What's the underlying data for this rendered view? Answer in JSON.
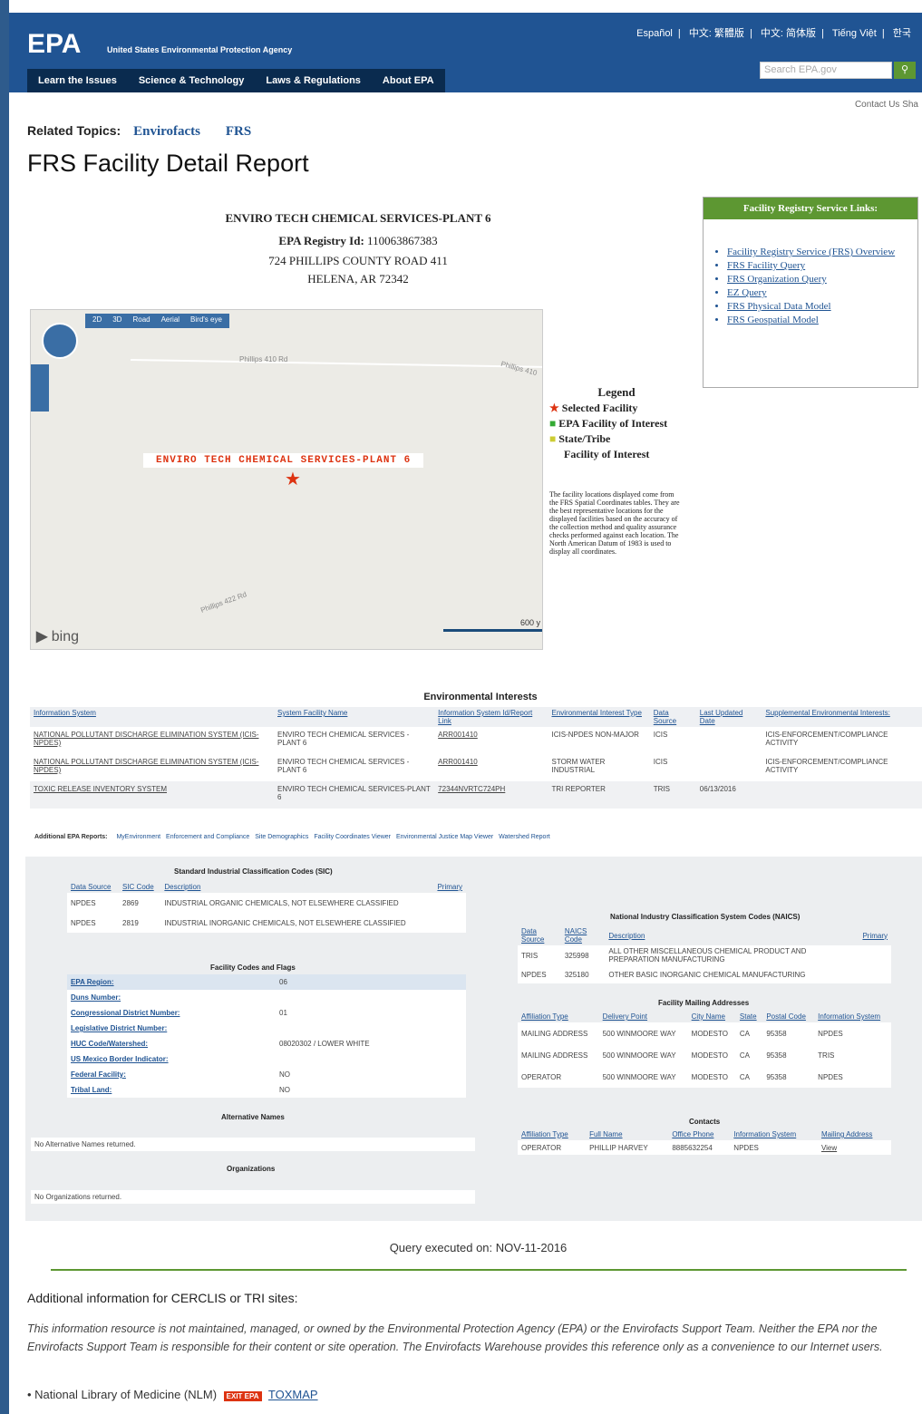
{
  "header": {
    "logo": "EPA",
    "agency": "United States Environmental Protection Agency",
    "languages": [
      "Español",
      "中文: 繁體版",
      "中文: 简体版",
      "Tiếng Việt",
      "한국"
    ],
    "search_placeholder": "Search EPA.gov",
    "nav": [
      "Learn the Issues",
      "Science & Technology",
      "Laws & Regulations",
      "About EPA"
    ],
    "utility": "Contact Us   Sha"
  },
  "related": {
    "label": "Related Topics:",
    "links": [
      "Envirofacts",
      "FRS"
    ]
  },
  "title": "FRS Facility Detail Report",
  "facility": {
    "name": "ENVIRO TECH CHEMICAL SERVICES-PLANT 6",
    "registry_label": "EPA Registry Id:",
    "registry_id": "110063867383",
    "address1": "724 PHILLIPS COUNTY ROAD 411",
    "address2": "HELENA, AR 72342"
  },
  "frs_links": {
    "title": "Facility Registry Service Links:",
    "items": [
      "Facility Registry Service (FRS) Overview",
      "FRS Facility Query",
      "FRS Organization Query",
      "EZ Query",
      "FRS Physical Data Model",
      "FRS Geospatial Model"
    ]
  },
  "map": {
    "toolbar": [
      "2D",
      "3D",
      "Road",
      "Aerial",
      "Bird's eye"
    ],
    "roads": [
      "Phillips 410 Rd",
      "Phillips 410",
      "Phillips 422 Rd"
    ],
    "label": "ENVIRO TECH CHEMICAL SERVICES-PLANT 6",
    "brand": "bing",
    "scale": "600 y"
  },
  "legend": {
    "title": "Legend",
    "items": [
      "Selected Facility",
      "EPA Facility of Interest",
      "State/Tribe",
      "Facility of Interest"
    ],
    "note": "The facility locations displayed come from the FRS Spatial Coordinates tables. They are the best representative locations for the displayed facilities based on the accuracy of the collection method and quality assurance checks performed against each location. The North American Datum of 1983 is used to display all coordinates."
  },
  "env_interests": {
    "title": "Environmental Interests",
    "columns": [
      "Information System",
      "System Facility Name",
      "Information System Id/Report Link",
      "Environmental Interest Type",
      "Data Source",
      "Last Updated Date",
      "Supplemental Environmental Interests:"
    ],
    "rows": [
      [
        "NATIONAL POLLUTANT DISCHARGE ELIMINATION SYSTEM (ICIS-NPDES)",
        "ENVIRO TECH CHEMICAL SERVICES - PLANT 6",
        "ARR001410",
        "ICIS-NPDES NON-MAJOR",
        "ICIS",
        "",
        "ICIS-ENFORCEMENT/COMPLIANCE ACTIVITY"
      ],
      [
        "NATIONAL POLLUTANT DISCHARGE ELIMINATION SYSTEM (ICIS-NPDES)",
        "ENVIRO TECH CHEMICAL SERVICES - PLANT 6",
        "ARR001410",
        "STORM WATER INDUSTRIAL",
        "ICIS",
        "",
        "ICIS-ENFORCEMENT/COMPLIANCE ACTIVITY"
      ],
      [
        "TOXIC RELEASE INVENTORY SYSTEM",
        "ENVIRO TECH CHEMICAL SERVICES-PLANT 6",
        "72344NVRTC724PH",
        "TRI REPORTER",
        "TRIS",
        "06/13/2016",
        ""
      ]
    ]
  },
  "additional_reports": {
    "label": "Additional EPA Reports:",
    "links": [
      "MyEnvironment",
      "Enforcement and Compliance",
      "Site Demographics",
      "Facility Coordinates Viewer",
      "Environmental Justice Map Viewer",
      "Watershed Report"
    ]
  },
  "sic": {
    "title": "Standard Industrial Classification Codes (SIC)",
    "columns": [
      "Data Source",
      "SIC Code",
      "Description",
      "Primary"
    ],
    "rows": [
      [
        "NPDES",
        "2869",
        "INDUSTRIAL ORGANIC CHEMICALS, NOT ELSEWHERE CLASSIFIED",
        ""
      ],
      [
        "NPDES",
        "2819",
        "INDUSTRIAL INORGANIC CHEMICALS, NOT ELSEWHERE CLASSIFIED",
        ""
      ]
    ]
  },
  "flags": {
    "title": "Facility Codes and Flags",
    "rows": [
      [
        "EPA Region:",
        "06"
      ],
      [
        "Duns Number:",
        ""
      ],
      [
        "Congressional District Number:",
        "01"
      ],
      [
        "Legislative District Number:",
        ""
      ],
      [
        "HUC Code/Watershed:",
        "08020302 / LOWER WHITE"
      ],
      [
        "US Mexico Border Indicator:",
        ""
      ],
      [
        "Federal Facility:",
        "NO"
      ],
      [
        "Tribal Land:",
        "NO"
      ]
    ]
  },
  "alt_names": {
    "title": "Alternative Names",
    "text": "No Alternative Names returned."
  },
  "orgs": {
    "title": "Organizations",
    "text": "No Organizations returned."
  },
  "naics": {
    "title": "National Industry Classification System Codes (NAICS)",
    "columns": [
      "Data Source",
      "NAICS Code",
      "Description",
      "Primary"
    ],
    "rows": [
      [
        "TRIS",
        "325998",
        "ALL OTHER MISCELLANEOUS CHEMICAL PRODUCT AND PREPARATION MANUFACTURING",
        ""
      ],
      [
        "NPDES",
        "325180",
        "OTHER BASIC INORGANIC CHEMICAL MANUFACTURING",
        ""
      ]
    ]
  },
  "mailing": {
    "title": "Facility Mailing Addresses",
    "columns": [
      "Affiliation Type",
      "Delivery Point",
      "City Name",
      "State",
      "Postal Code",
      "Information System"
    ],
    "rows": [
      [
        "MAILING ADDRESS",
        "500 WINMOORE WAY",
        "MODESTO",
        "CA",
        "95358",
        "NPDES"
      ],
      [
        "MAILING ADDRESS",
        "500 WINMOORE WAY",
        "MODESTO",
        "CA",
        "95358",
        "TRIS"
      ],
      [
        "OPERATOR",
        "500 WINMOORE WAY",
        "MODESTO",
        "CA",
        "95358",
        "NPDES"
      ]
    ]
  },
  "contacts": {
    "title": "Contacts",
    "columns": [
      "Affiliation Type",
      "Full Name",
      "Office Phone",
      "Information System",
      "Mailing Address"
    ],
    "rows": [
      [
        "OPERATOR",
        "PHILLIP HARVEY",
        "8885632254",
        "NPDES",
        "View"
      ]
    ]
  },
  "query": "Query executed on: NOV-11-2016",
  "additional_info": {
    "title": "Additional information for CERCLIS or TRI sites:",
    "disclaimer": "This information resource is not maintained, managed, or owned by the Environmental Protection Agency (EPA) or the Envirofacts Support Team. Neither the EPA nor the Envirofacts Support Team is responsible for their content or site operation. The Envirofacts Warehouse provides this reference only as a convenience to our Internet users.",
    "nlm": "National Library of Medicine (NLM)",
    "exit": "EXIT EPA",
    "toxmap": "TOXMAP"
  }
}
